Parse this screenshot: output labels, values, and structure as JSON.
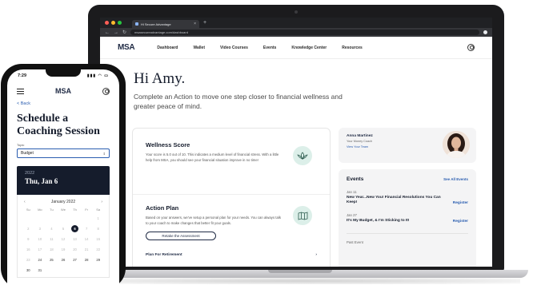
{
  "browser": {
    "tab_title": "Hi Secure Advantage",
    "tab_close": "×",
    "new_tab": "+",
    "url": "msasecureadvantage.com/dashboard",
    "window_dots": [
      "#ff5f57",
      "#febc2e",
      "#28c840"
    ]
  },
  "site": {
    "logo": "MSA",
    "nav": [
      "Dashboard",
      "Wallet",
      "Video Courses",
      "Events",
      "Knowledge Center",
      "Resources"
    ]
  },
  "hero": {
    "greeting": "Hi Amy.",
    "subtitle": "Complete an Action to move one step closer to financial wellness and greater peace of mind."
  },
  "wellness": {
    "title": "Wellness Score",
    "body": "Your score is 5.0 out of 10. This indicates a medium level of financial stress. With a little help from MSA, you should see your financial situation improve in no time!",
    "icon": "lotus-icon"
  },
  "action_plan": {
    "title": "Action Plan",
    "body": "Based on your answers, we've setup a personal plan for your needs. You can always talk to your coach to make changes that better fit your goals.",
    "button": "Retake the Assessment",
    "icon": "map-icon",
    "first_item": "Plan For Retirement"
  },
  "coach": {
    "name": "Anna Martinez",
    "role": "Your Money Coach",
    "link": "View Your Team"
  },
  "events": {
    "title": "Events",
    "see_all": "See All Events",
    "items": [
      {
        "date": "Jan 11",
        "title": "New Year...New You! Financial Resolutions You Can Keep!",
        "action": "Register"
      },
      {
        "date": "Jan 27",
        "title": "It's My Budget, & I'm Sticking to It!",
        "action": "Register"
      }
    ],
    "past_label": "Past Event"
  },
  "phone": {
    "time": "7:29",
    "status_icons": "▮▮▮ ◠ ▭",
    "logo": "MSA",
    "back": "< Back",
    "title": "Schedule a Coaching Session",
    "topic_label": "Topic",
    "topic_value": "Budget",
    "calendar": {
      "year": "2022",
      "selected_label": "Thu, Jan 6",
      "month": "January 2022",
      "prev": "‹",
      "next": "›",
      "weekdays": [
        "Su",
        "Mo",
        "Tu",
        "We",
        "Th",
        "Fr",
        "Sa"
      ],
      "days": [
        "",
        "",
        "",
        "",
        "",
        "",
        "1",
        "2",
        "3",
        "4",
        "5",
        "6",
        "7",
        "8",
        "9",
        "10",
        "11",
        "12",
        "13",
        "14",
        "15",
        "16",
        "17",
        "18",
        "19",
        "20",
        "21",
        "22",
        "23",
        "24",
        "25",
        "26",
        "27",
        "28",
        "29",
        "30",
        "31"
      ],
      "selected_day": "6",
      "enabled_from": 24
    }
  }
}
